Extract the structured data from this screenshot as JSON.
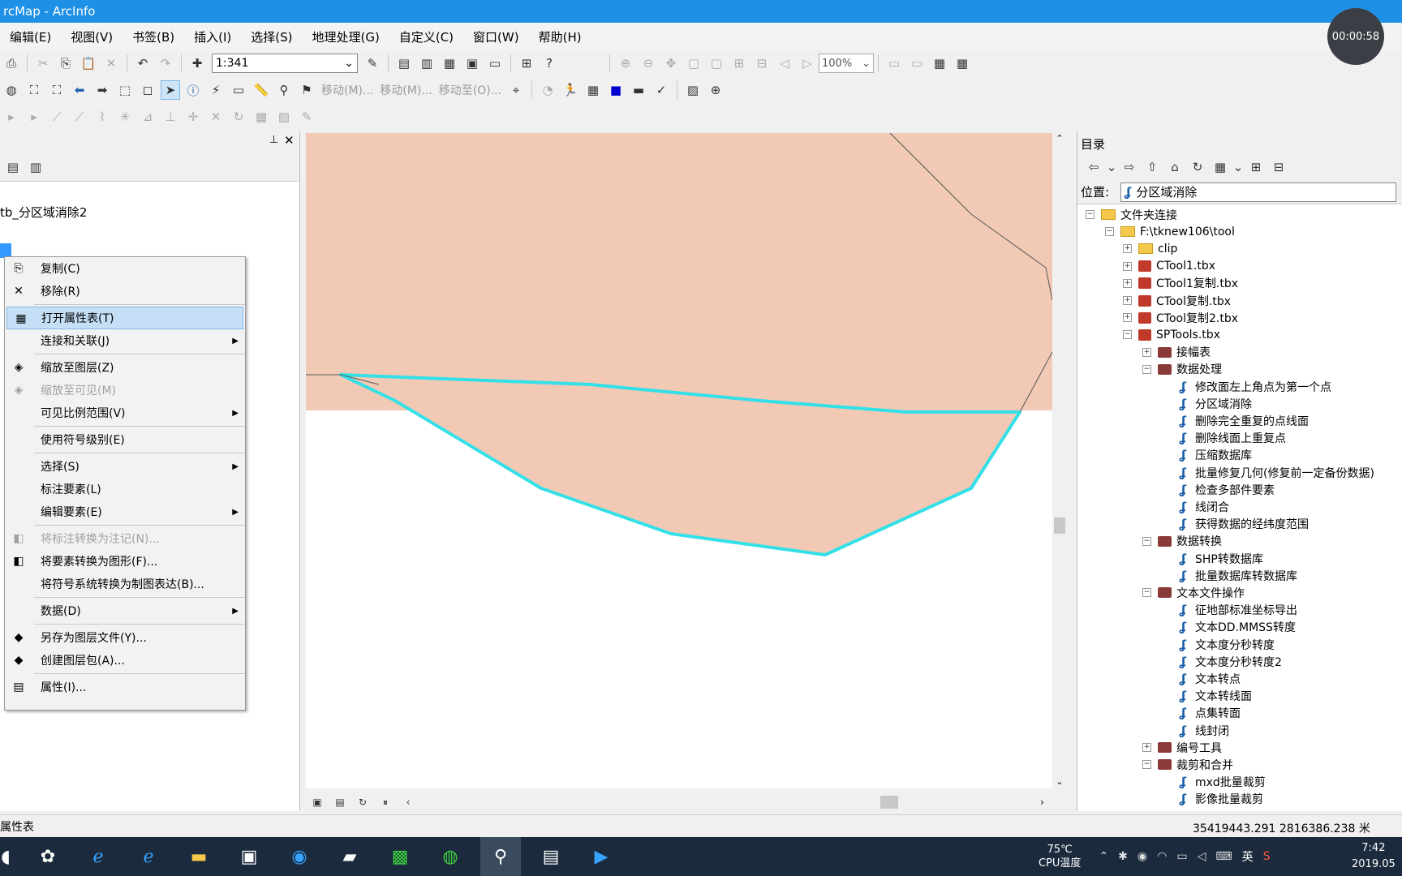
{
  "window": {
    "title": "rcMap - ArcInfo"
  },
  "timer": "00:00:58",
  "menu": [
    "编辑(E)",
    "视图(V)",
    "书签(B)",
    "插入(I)",
    "选择(S)",
    "地理处理(G)",
    "自定义(C)",
    "窗口(W)",
    "帮助(H)"
  ],
  "toolbar": {
    "scale": "1:341",
    "zoom": "100%",
    "move1": "移动(M)...",
    "move2": "移动(M)...",
    "moveto": "移动至(O)..."
  },
  "toc": {
    "group_label": "tb_分区域消除2"
  },
  "context_menu": [
    {
      "label": "复制(C)",
      "icon": "copy-icon",
      "glyph": "⎘",
      "enabled": true
    },
    {
      "label": "移除(R)",
      "icon": "remove-icon",
      "glyph": "✕",
      "enabled": true
    },
    {
      "sep": true
    },
    {
      "label": "打开属性表(T)",
      "icon": "table-icon",
      "glyph": "▦",
      "enabled": true,
      "highlight": true
    },
    {
      "label": "连接和关联(J)",
      "icon": "",
      "glyph": "",
      "enabled": true,
      "submenu": true
    },
    {
      "sep": true
    },
    {
      "label": "缩放至图层(Z)",
      "icon": "zoom-layer-icon",
      "glyph": "◈",
      "enabled": true
    },
    {
      "label": "缩放至可见(M)",
      "icon": "zoom-visible-icon",
      "glyph": "◈",
      "enabled": false
    },
    {
      "label": "可见比例范围(V)",
      "icon": "",
      "glyph": "",
      "enabled": true,
      "submenu": true
    },
    {
      "sep": true
    },
    {
      "label": "使用符号级别(E)",
      "icon": "",
      "glyph": "",
      "enabled": true
    },
    {
      "sep": true
    },
    {
      "label": "选择(S)",
      "icon": "",
      "glyph": "",
      "enabled": true,
      "submenu": true
    },
    {
      "label": "标注要素(L)",
      "icon": "",
      "glyph": "",
      "enabled": true
    },
    {
      "label": "编辑要素(E)",
      "icon": "",
      "glyph": "",
      "enabled": true,
      "submenu": true
    },
    {
      "sep": true
    },
    {
      "label": "将标注转换为注记(N)...",
      "icon": "convert-label-icon",
      "glyph": "◧",
      "enabled": false
    },
    {
      "label": "将要素转换为图形(F)...",
      "icon": "convert-graphic-icon",
      "glyph": "◧",
      "enabled": true
    },
    {
      "label": "将符号系统转换为制图表达(B)...",
      "icon": "",
      "glyph": "",
      "enabled": true
    },
    {
      "sep": true
    },
    {
      "label": "数据(D)",
      "icon": "",
      "glyph": "",
      "enabled": true,
      "submenu": true
    },
    {
      "sep": true
    },
    {
      "label": "另存为图层文件(Y)...",
      "icon": "layer-file-icon",
      "glyph": "◆",
      "enabled": true
    },
    {
      "label": "创建图层包(A)...",
      "icon": "layer-package-icon",
      "glyph": "◆",
      "enabled": true
    },
    {
      "sep": true
    },
    {
      "label": "属性(I)...",
      "icon": "properties-icon",
      "glyph": "▤",
      "enabled": true
    }
  ],
  "catalog": {
    "title": "目录",
    "location_label": "位置:",
    "location_value": "分区域消除",
    "tree": [
      {
        "label": "文件夹连接",
        "level": 0,
        "type": "folder",
        "exp": "−"
      },
      {
        "label": "F:\\tknew106\\tool",
        "level": 1,
        "type": "folder",
        "exp": "−"
      },
      {
        "label": "clip",
        "level": 2,
        "type": "folder",
        "exp": "+"
      },
      {
        "label": "CTool1.tbx",
        "level": 2,
        "type": "tbx",
        "exp": "+"
      },
      {
        "label": "CTool1复制.tbx",
        "level": 2,
        "type": "tbx",
        "exp": "+"
      },
      {
        "label": "CTool复制.tbx",
        "level": 2,
        "type": "tbx",
        "exp": "+"
      },
      {
        "label": "CTool复制2.tbx",
        "level": 2,
        "type": "tbx",
        "exp": "+"
      },
      {
        "label": "SPTools.tbx",
        "level": 2,
        "type": "tbx",
        "exp": "−"
      },
      {
        "label": "接幅表",
        "level": 3,
        "type": "toolset",
        "exp": "+"
      },
      {
        "label": "数据处理",
        "level": 3,
        "type": "toolset",
        "exp": "−"
      },
      {
        "label": "修改面左上角点为第一个点",
        "level": 4,
        "type": "script"
      },
      {
        "label": "分区域消除",
        "level": 4,
        "type": "script"
      },
      {
        "label": "删除完全重复的点线面",
        "level": 4,
        "type": "script"
      },
      {
        "label": "删除线面上重复点",
        "level": 4,
        "type": "script"
      },
      {
        "label": "压缩数据库",
        "level": 4,
        "type": "script"
      },
      {
        "label": "批量修复几何(修复前一定备份数据)",
        "level": 4,
        "type": "script"
      },
      {
        "label": "检查多部件要素",
        "level": 4,
        "type": "script"
      },
      {
        "label": "线闭合",
        "level": 4,
        "type": "script"
      },
      {
        "label": "获得数据的经纬度范围",
        "level": 4,
        "type": "script"
      },
      {
        "label": "数据转换",
        "level": 3,
        "type": "toolset",
        "exp": "−"
      },
      {
        "label": "SHP转数据库",
        "level": 4,
        "type": "script"
      },
      {
        "label": "批量数据库转数据库",
        "level": 4,
        "type": "script"
      },
      {
        "label": "文本文件操作",
        "level": 3,
        "type": "toolset",
        "exp": "−"
      },
      {
        "label": "征地部标准坐标导出",
        "level": 4,
        "type": "script"
      },
      {
        "label": "文本DD.MMSS转度",
        "level": 4,
        "type": "script"
      },
      {
        "label": "文本度分秒转度",
        "level": 4,
        "type": "script"
      },
      {
        "label": "文本度分秒转度2",
        "level": 4,
        "type": "script"
      },
      {
        "label": "文本转点",
        "level": 4,
        "type": "script"
      },
      {
        "label": "文本转线面",
        "level": 4,
        "type": "script"
      },
      {
        "label": "点集转面",
        "level": 4,
        "type": "script"
      },
      {
        "label": "线封闭",
        "level": 4,
        "type": "script"
      },
      {
        "label": "编号工具",
        "level": 3,
        "type": "toolset",
        "exp": "+"
      },
      {
        "label": "裁剪和合并",
        "level": 3,
        "type": "toolset",
        "exp": "−"
      },
      {
        "label": "mxd批量裁剪",
        "level": 4,
        "type": "script"
      },
      {
        "label": "影像批量裁剪",
        "level": 4,
        "type": "script"
      }
    ]
  },
  "status": {
    "left": "属性表",
    "coords": "35419443.291  2816386.238 米"
  },
  "taskbar": {
    "temp": "75℃",
    "temp_label": "CPU温度",
    "ime": "英",
    "time": "7:42",
    "date": "2019.05"
  },
  "colors": {
    "titlebar": "#1e90e6",
    "polygon_fill": "#f2c9b5",
    "selection": "#33e0e8"
  }
}
